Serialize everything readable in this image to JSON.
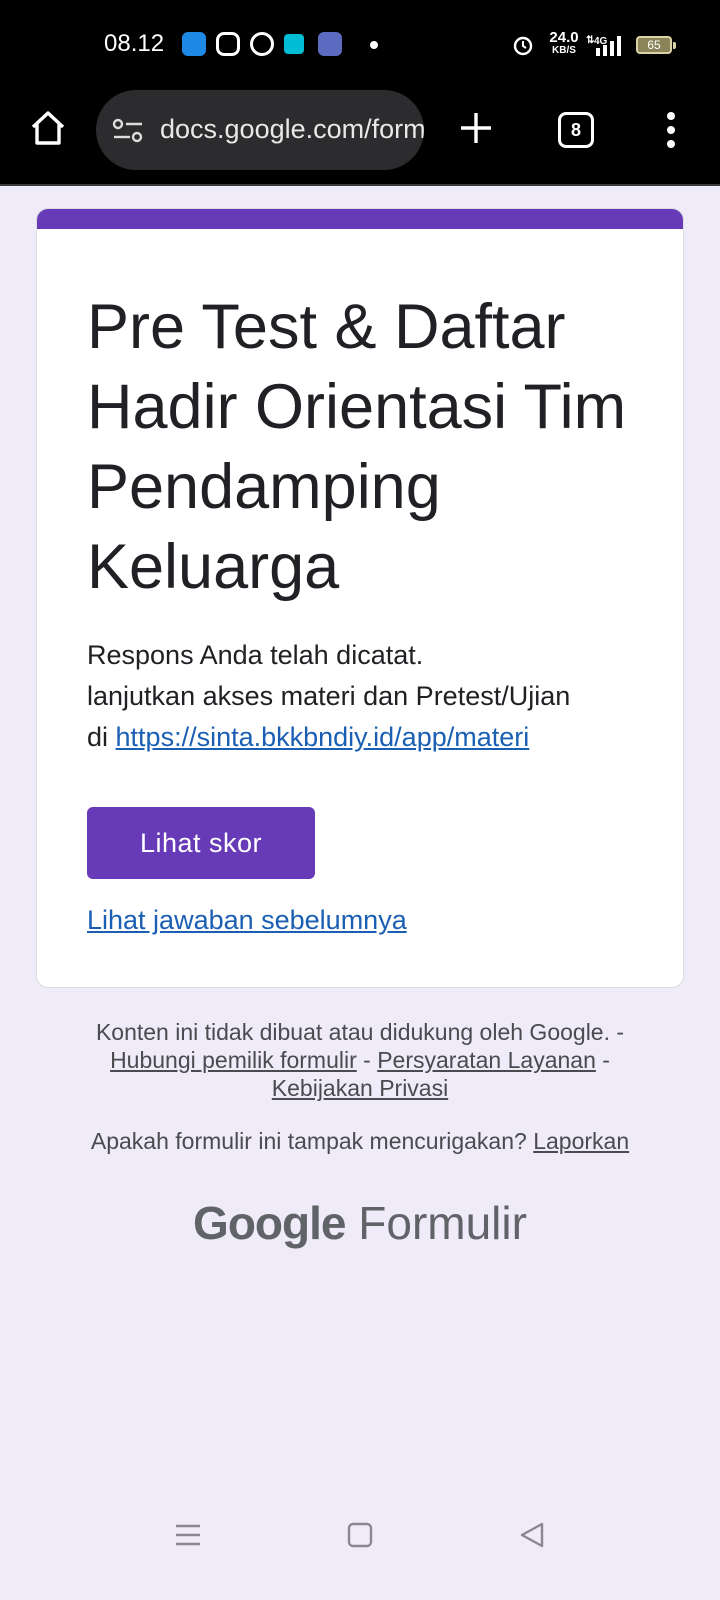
{
  "status_bar": {
    "time": "08.12",
    "net_speed_value": "24.0",
    "net_speed_unit": "KB/S",
    "network_type": "4G",
    "battery": "65"
  },
  "browser": {
    "url": "docs.google.com/forms/d/e",
    "tab_count": "8"
  },
  "form": {
    "title": "Pre Test & Daftar Hadir Orientasi Tim Pendamping Keluarga",
    "message_line1": "Respons Anda telah dicatat.",
    "message_line2": "lanjutkan akses materi dan Pretest/Ujian",
    "message_prefix": "di ",
    "message_link": "https://sinta.bkkbndiy.id/app/materi",
    "score_button": "Lihat skor",
    "prev_answers_link": "Lihat jawaban sebelumnya"
  },
  "footer": {
    "disclaimer": "Konten ini tidak dibuat atau didukung oleh Google.",
    "sep": " - ",
    "contact_owner": "Hubungi pemilik formulir",
    "terms": "Persyaratan Layanan",
    "privacy": "Kebijakan Privasi",
    "suspicious_question": "Apakah formulir ini tampak mencurigakan? ",
    "report_link": "Laporkan",
    "brand_google": "Google",
    "brand_product": "Formulir"
  },
  "colors": {
    "accent": "#673ab7",
    "background": "#efebf8",
    "link": "#1a5fb4"
  }
}
